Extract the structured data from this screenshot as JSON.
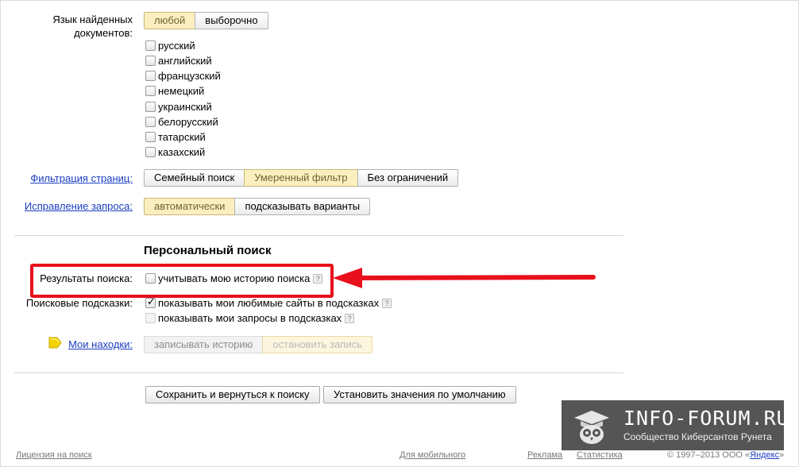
{
  "language": {
    "label": "Язык найденных документов:",
    "options": [
      "любой",
      "выборочно"
    ],
    "languages": [
      "русский",
      "английский",
      "французский",
      "немецкий",
      "украинский",
      "белорусский",
      "татарский",
      "казахский"
    ]
  },
  "filter": {
    "label": "Фильтрация страниц:",
    "options": [
      "Семейный поиск",
      "Умеренный фильтр",
      "Без ограничений"
    ],
    "selected": "Умеренный фильтр"
  },
  "correction": {
    "label": "Исправление запроса:",
    "options": [
      "автоматически",
      "подсказывать варианты"
    ],
    "selected": "автоматически"
  },
  "personal": {
    "heading": "Персональный поиск",
    "results_label": "Результаты поиска:",
    "history_option": "учитывать мою историю поиска",
    "suggest_label": "Поисковые подсказки:",
    "suggest_sites": "показывать мои любимые сайты в подсказках",
    "suggest_queries": "показывать мои запросы в подсказках",
    "finds_label": "Мои находки:",
    "finds_options": [
      "записывать историю",
      "остановить запись"
    ]
  },
  "buttons": {
    "save": "Сохранить и вернуться к поиску",
    "defaults": "Установить значения по умолчанию"
  },
  "footer": {
    "license": "Лицензия на поиск",
    "mobile": "Для мобильного",
    "ads": "Реклама",
    "stats": "Статистика",
    "copyright": "© 1997–2013 ООО «",
    "company": "Яндекс",
    "copyright_end": "»"
  },
  "watermark": {
    "title": "INFO-FORUM.RU",
    "subtitle": "Сообщество Киберсантов Рунета"
  },
  "colors": {
    "accent_red": "#e8101c",
    "link": "#1a3dc1",
    "selected_bg": "#fbefc0"
  }
}
